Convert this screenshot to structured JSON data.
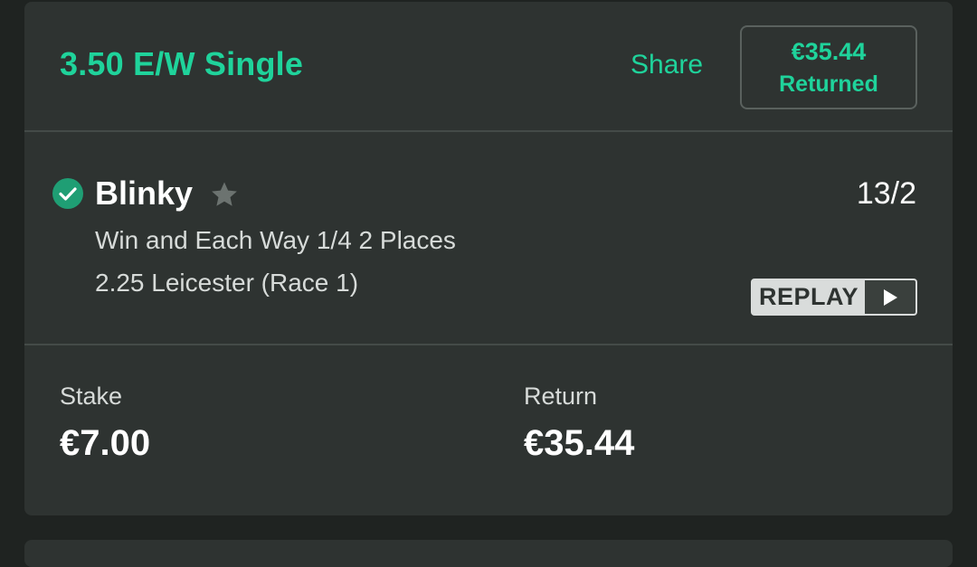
{
  "bet": {
    "title": "3.50 E/W Single",
    "share_label": "Share",
    "returned_amount": "€35.44",
    "returned_label": "Returned"
  },
  "selection": {
    "name": "Blinky",
    "odds": "13/2",
    "market": "Win and Each Way 1/4 2 Places",
    "event": "2.25 Leicester (Race 1)",
    "replay_label": "REPLAY",
    "status": "won"
  },
  "summary": {
    "stake_label": "Stake",
    "stake_value": "€7.00",
    "return_label": "Return",
    "return_value": "€35.44"
  },
  "icons": {
    "check": "check-circle-icon",
    "star": "star-icon",
    "play": "play-icon"
  },
  "colors": {
    "accent": "#1fd39b",
    "won_badge": "#1f9e74",
    "card_bg": "#2e3331"
  }
}
